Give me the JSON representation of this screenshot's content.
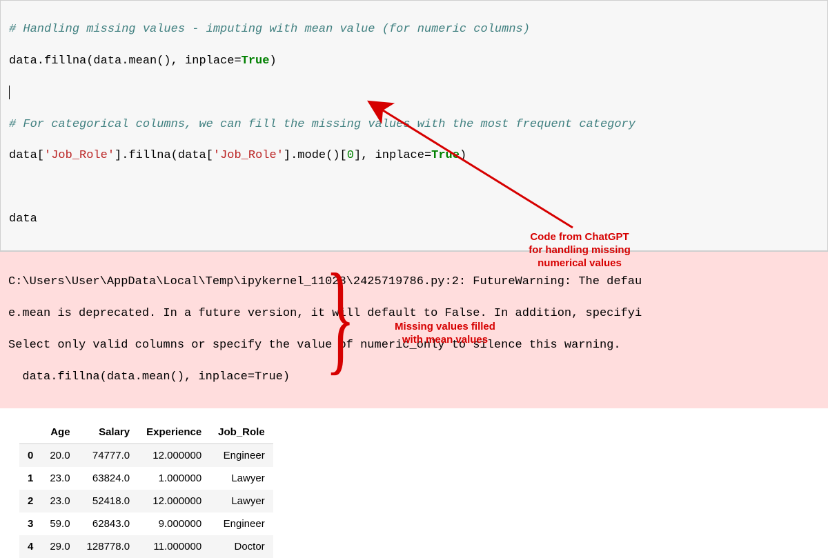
{
  "code": {
    "comment1": "# Handling missing values - imputing with mean value (for numeric columns)",
    "line1_a": "data.fillna(data.mean(), inplace=",
    "line1_true": "True",
    "line1_b": ")",
    "comment2": "# For categorical columns, we can fill the missing values with the most frequent category",
    "line2_a": "data[",
    "line2_str1": "'Job_Role'",
    "line2_b": "].fillna(data[",
    "line2_str2": "'Job_Role'",
    "line2_c": "].mode()[",
    "line2_num": "0",
    "line2_d": "], inplace=",
    "line2_true": "True",
    "line2_e": ")",
    "line3": "data"
  },
  "warning": {
    "l1": "C:\\Users\\User\\AppData\\Local\\Temp\\ipykernel_11028\\2425719786.py:2: FutureWarning: The defau",
    "l2": "e.mean is deprecated. In a future version, it will default to False. In addition, specifyi",
    "l3": "Select only valid columns or specify the value of numeric_only to silence this warning.",
    "l4": "  data.fillna(data.mean(), inplace=True)"
  },
  "table": {
    "headers": [
      "",
      "Age",
      "Salary",
      "Experience",
      "Job_Role"
    ],
    "rows": [
      {
        "idx": "0",
        "age": "20.0",
        "salary": "74777.0",
        "exp": "12.000000",
        "role": "Engineer"
      },
      {
        "idx": "1",
        "age": "23.0",
        "salary": "63824.0",
        "exp": "1.000000",
        "role": "Lawyer"
      },
      {
        "idx": "2",
        "age": "23.0",
        "salary": "52418.0",
        "exp": "12.000000",
        "role": "Lawyer"
      },
      {
        "idx": "3",
        "age": "59.0",
        "salary": "62843.0",
        "exp": "9.000000",
        "role": "Engineer"
      },
      {
        "idx": "4",
        "age": "29.0",
        "salary": "128778.0",
        "exp": "11.000000",
        "role": "Doctor"
      }
    ]
  },
  "annotations": {
    "a1_l1": "Code from ChatGPT",
    "a1_l2": "for handling missing",
    "a1_l3": "numerical values",
    "a2_l1": "Missing values filled",
    "a2_l2": "with mean values"
  }
}
